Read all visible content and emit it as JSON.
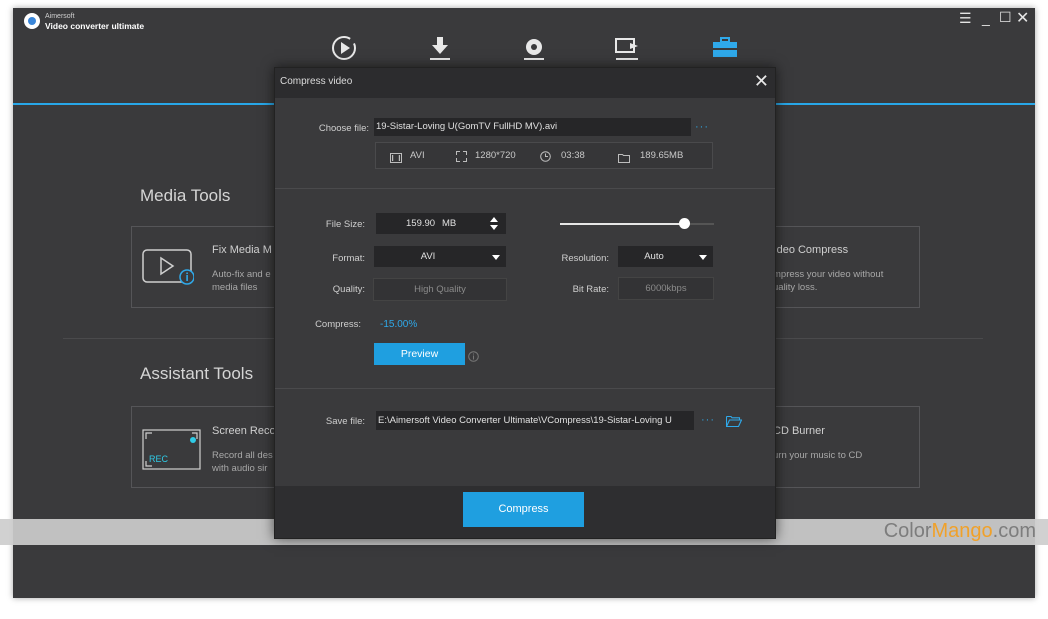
{
  "app": {
    "brand_top": "Aimersoft",
    "brand_name": "Video converter ultimate",
    "window_controls": [
      "menu-icon",
      "minimize-icon",
      "maximize-icon",
      "close-icon"
    ],
    "nav_icons": [
      "convert-icon",
      "download-icon",
      "burn-icon",
      "transfer-icon",
      "toolbox-icon"
    ],
    "accent": "#28a7e8"
  },
  "media_tools": {
    "title": "Media Tools",
    "fix": {
      "title": "Fix Media M",
      "desc1": "Auto-fix and e",
      "desc2": "media files"
    },
    "compress": {
      "title": "Video Compress",
      "desc1": "mpress your video without",
      "desc2": "uality loss."
    }
  },
  "assistant_tools": {
    "title": "Assistant Tools",
    "screen": {
      "title": "Screen Reco",
      "desc1": "Record all des",
      "desc2": "with audio sir",
      "rec_label": "REC"
    },
    "cd": {
      "title": "CD Burner",
      "desc1": "urn your music to CD"
    }
  },
  "dialog": {
    "title": "Compress video",
    "choose_label": "Choose file:",
    "choose_value": "19-Sistar-Loving U(GomTV FullHD MV).avi",
    "choose_more": "···",
    "info": {
      "format": "AVI",
      "resolution": "1280*720",
      "duration": "03:38",
      "size": "189.65MB"
    },
    "filesize_label": "File Size:",
    "filesize_value": "159.90",
    "filesize_unit": "MB",
    "slider_level": 0.81,
    "format_label": "Format:",
    "format_value": "AVI",
    "resolution_label": "Resolution:",
    "resolution_value": "Auto",
    "quality_label": "Quality:",
    "quality_value": "High Quality",
    "bitrate_label": "Bit Rate:",
    "bitrate_value": "6000kbps",
    "compress_label": "Compress:",
    "compress_value": "-15.00%",
    "preview_label": "Preview",
    "save_label": "Save file:",
    "save_value": "E:\\Aimersoft Video Converter Ultimate\\VCompress\\19-Sistar-Loving U",
    "save_more": "···",
    "compress_button": "Compress"
  },
  "watermark": {
    "part1": "Color",
    "part2": "Mango",
    "part3": ".com"
  }
}
